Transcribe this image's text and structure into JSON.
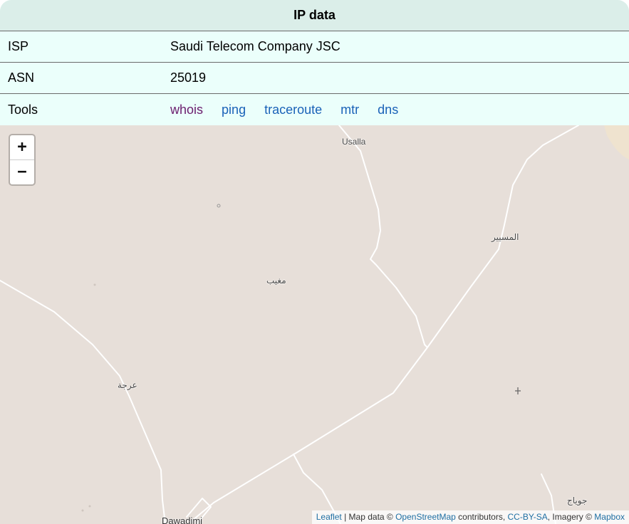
{
  "ip_table": {
    "title": "IP data",
    "rows": [
      {
        "label": "ISP",
        "value": "Saudi Telecom Company JSC"
      },
      {
        "label": "ASN",
        "value": "25019"
      }
    ],
    "tools": {
      "label": "Tools",
      "links": [
        "whois",
        "ping",
        "traceroute",
        "mtr",
        "dns"
      ]
    }
  },
  "map": {
    "zoom_in": "+",
    "zoom_out": "−",
    "place_labels": {
      "usalla": "Usalla",
      "almusayyir": "المسيير",
      "mughayyib": "مغيب",
      "arja": "عرجة",
      "dawadimi": "Dawadimi",
      "jawwaj": "جوياج"
    },
    "attribution": {
      "leaflet": "Leaflet",
      "map_data": " | Map data © ",
      "osm": "OpenStreetMap",
      "contributors": " contributors, ",
      "license": "CC-BY-SA",
      "imagery": ", Imagery © ",
      "mapbox": "Mapbox"
    }
  },
  "colors": {
    "table_bg": "#ebfffb",
    "header_bg": "#dbeee9",
    "link": "#1a62b8",
    "visited_link": "#6b1d6e",
    "map_bg": "#e7dfd9",
    "road": "#ffffff"
  }
}
